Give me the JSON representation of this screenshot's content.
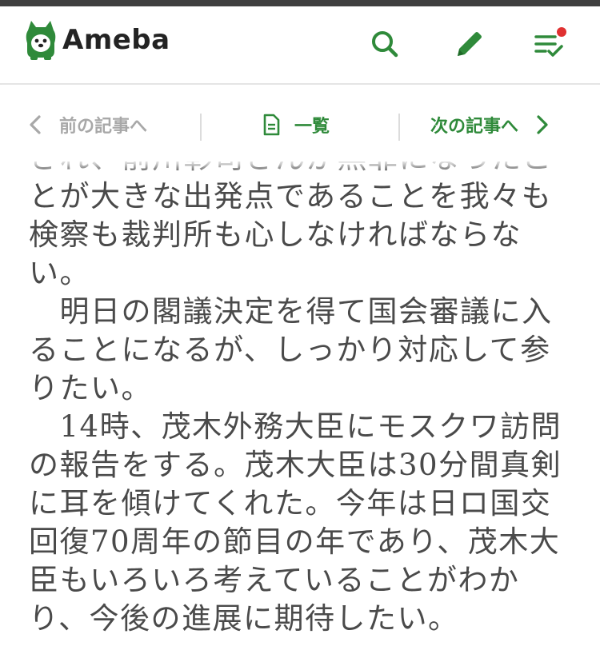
{
  "header": {
    "logo_text": "Ameba",
    "icons": [
      "search-icon",
      "pencil-icon",
      "list-check-icon"
    ],
    "notification_dot_color": "#e03131"
  },
  "nav": {
    "prev_label": "前の記事へ",
    "list_label": "一覧",
    "next_label": "次の記事へ"
  },
  "colors": {
    "accent": "#2f8a3a",
    "disabled": "#a8a8a8",
    "text": "#4a4a4a"
  },
  "article": {
    "lines": [
      "され、前川彰司さんが無罪になったこ",
      "とが大きな出発点であることを我々も",
      "検察も裁判所も心しなければならな",
      "い。",
      "　明日の閣議決定を得て国会審議に入",
      "ることになるが、しっかり対応して参",
      "りたい。",
      "　14時、茂木外務大臣にモスクワ訪問",
      "の報告をする。茂木大臣は30分間真剣",
      "に耳を傾けてくれた。今年は日ロ国交",
      "回復70周年の節目の年であり、茂木大",
      "臣もいろいろ考えていることがわか",
      "り、今後の進展に期待したい。"
    ]
  }
}
